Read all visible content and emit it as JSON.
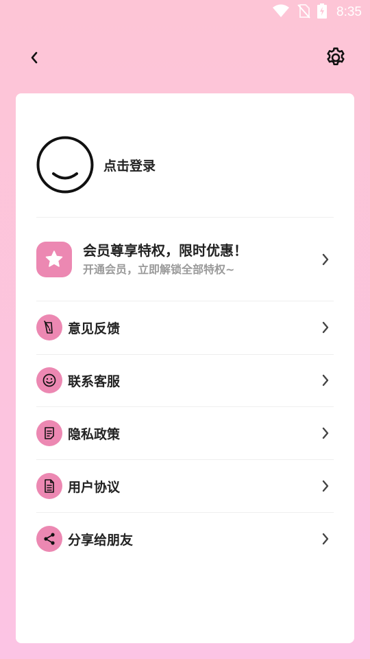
{
  "status_bar": {
    "time": "8:35",
    "icons": [
      "wifi-icon",
      "no-sim-icon",
      "battery-charging-icon"
    ]
  },
  "header": {
    "back_icon": "chevron-left-icon",
    "settings_icon": "gear-icon"
  },
  "profile": {
    "avatar_icon": "smiley-avatar-icon",
    "login_label": "点击登录"
  },
  "vip": {
    "icon": "star-badge-icon",
    "title": "会员尊享特权，限时优惠！",
    "subtitle": "开通会员，立即解锁全部特权~"
  },
  "menu": {
    "items": [
      {
        "label": "意见反馈",
        "icon": "feedback-icon"
      },
      {
        "label": "联系客服",
        "icon": "smile-service-icon"
      },
      {
        "label": "隐私政策",
        "icon": "privacy-document-icon"
      },
      {
        "label": "用户协议",
        "icon": "agreement-document-icon"
      },
      {
        "label": "分享给朋友",
        "icon": "share-icon"
      }
    ]
  },
  "colors": {
    "background_top": "#fdc5d6",
    "background_bottom": "#fcc4e4",
    "accent": "#ec88b2",
    "card": "#ffffff"
  }
}
